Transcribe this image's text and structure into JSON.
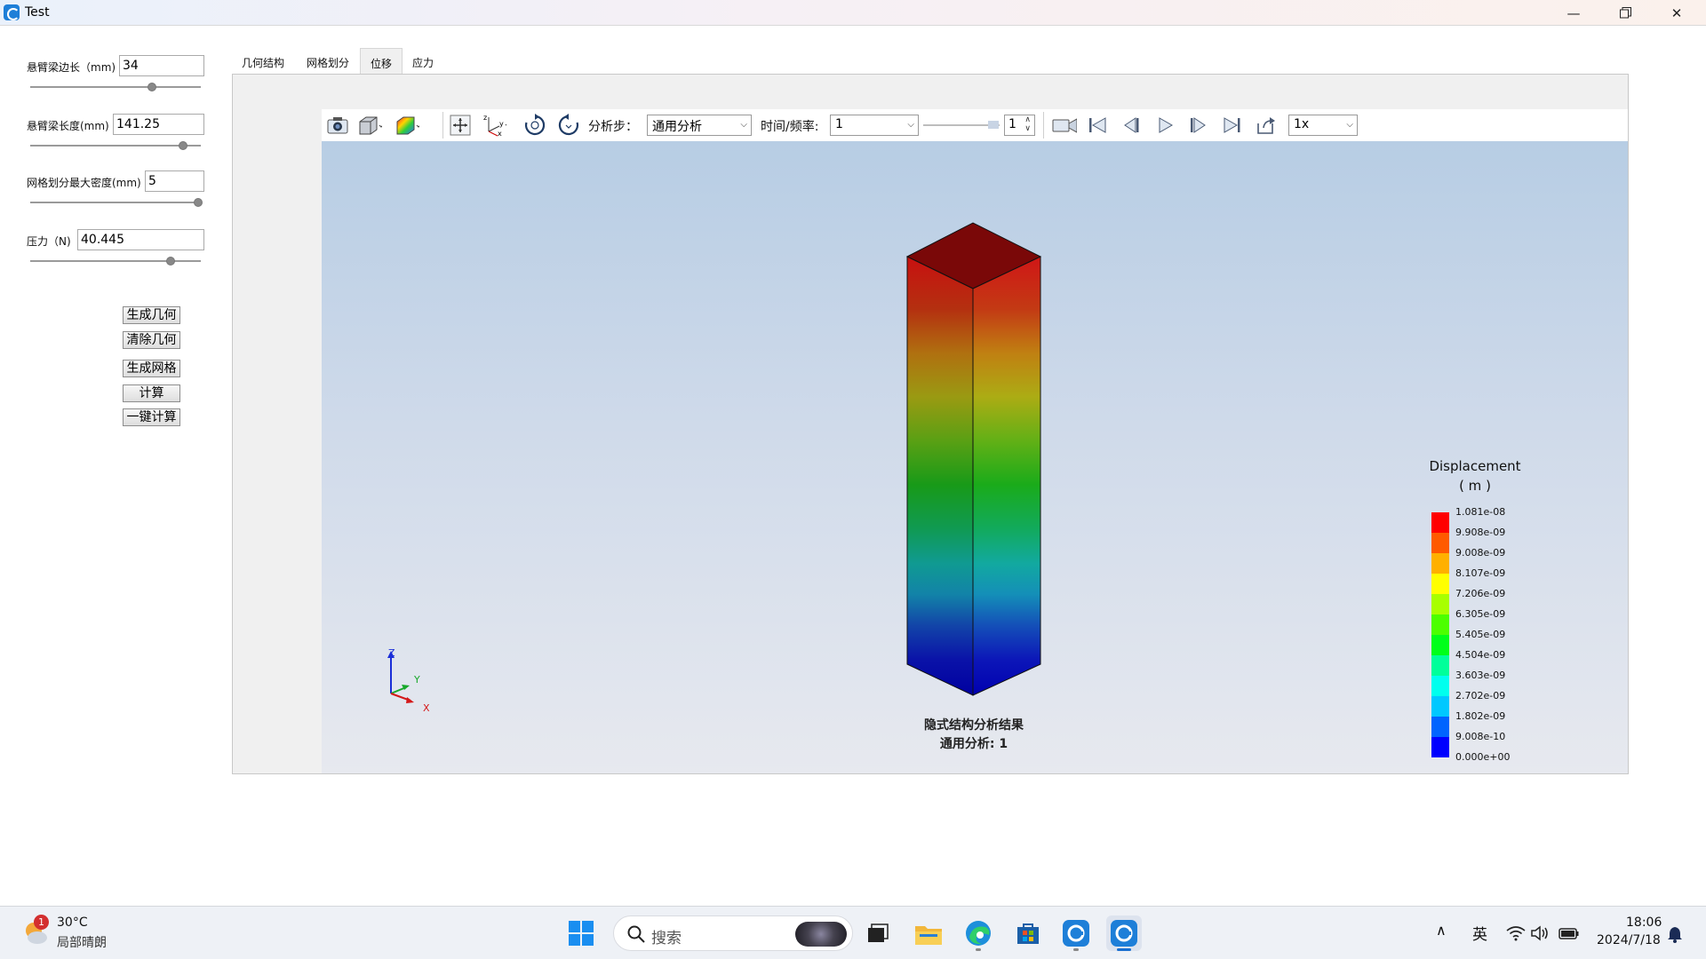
{
  "window": {
    "title": "Test"
  },
  "params": [
    {
      "label": "悬臂梁边长（mm)",
      "value": "34",
      "slider": 0.71
    },
    {
      "label": "悬臂梁长度(mm)",
      "value": "141.25",
      "slider": 0.89
    },
    {
      "label": "网格划分最大密度(mm)",
      "value": "5",
      "slider": 1.0
    },
    {
      "label": "压力（N)",
      "value": "40.445",
      "slider": 0.83
    }
  ],
  "buttons": {
    "gen_geometry": "生成几何",
    "clear_geometry": "清除几何",
    "gen_mesh": "生成网格",
    "compute": "计算",
    "one_click": "一键计算"
  },
  "tabs": [
    "几何结构",
    "网格划分",
    "位移",
    "应力"
  ],
  "active_tab": "位移",
  "toolbar": {
    "step_label": "分析步：",
    "step_value": "通用分析",
    "time_label": "时间/频率:",
    "time_value": "1",
    "frame_value": "1",
    "speed_value": "1x"
  },
  "legend": {
    "title": "Displacement",
    "unit": "( m )",
    "ticks": [
      "1.081e-08",
      "9.908e-09",
      "9.008e-09",
      "8.107e-09",
      "7.206e-09",
      "6.305e-09",
      "5.405e-09",
      "4.504e-09",
      "3.603e-09",
      "2.702e-09",
      "1.802e-09",
      "9.008e-10",
      "0.000e+00"
    ],
    "colors": [
      "#ff0000",
      "#ff5a00",
      "#ffb000",
      "#ffff00",
      "#a8ff00",
      "#4cff00",
      "#00ff1a",
      "#00ff9a",
      "#00ffee",
      "#00c8ff",
      "#0064ff",
      "#0000ff"
    ]
  },
  "axes": {
    "z": "Z",
    "y": "Y",
    "x": "X"
  },
  "caption": {
    "line1": "隐式结构分析结果",
    "line2": "通用分析: 1"
  },
  "taskbar": {
    "weather_temp": "30°C",
    "weather_desc": "局部晴朗",
    "weather_badge": "1",
    "search_placeholder": "搜索",
    "ime": "英",
    "time": "18:06",
    "date": "2024/7/18"
  }
}
